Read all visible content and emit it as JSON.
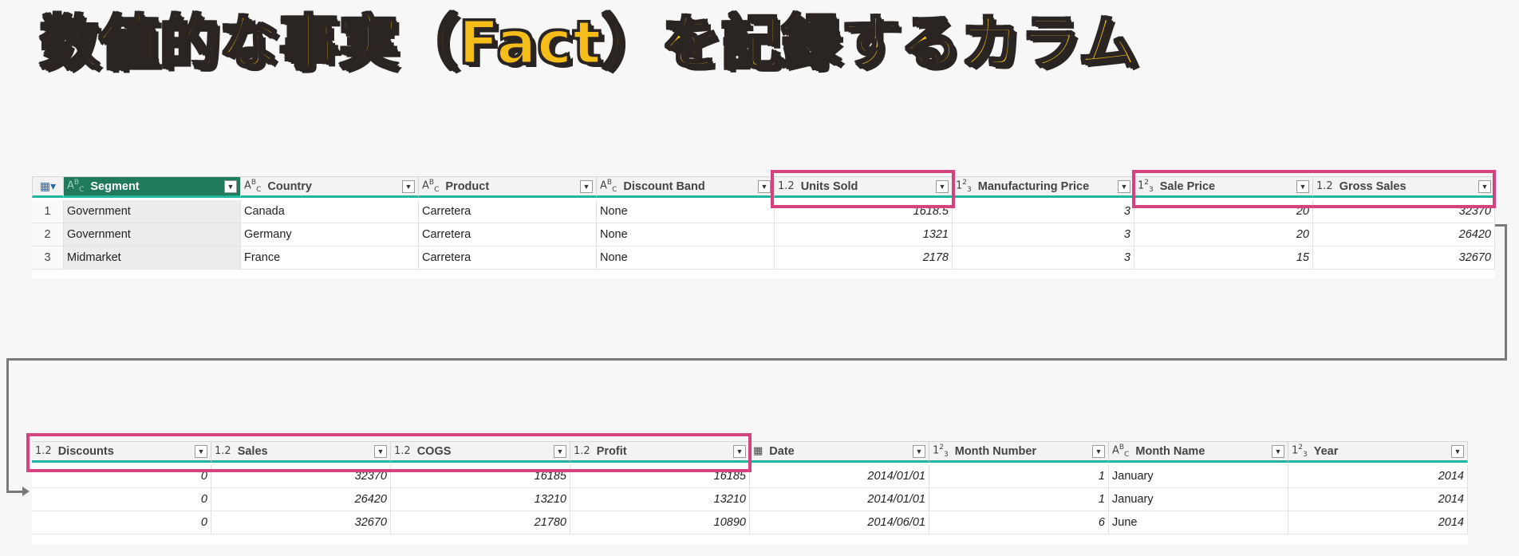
{
  "title": "数値的な事実（Fact）を記録するカラム",
  "colors": {
    "highlight": "#d6417f",
    "selected_header": "#227a5c",
    "underline": "#1fb59e",
    "title_fill": "#f5bd19"
  },
  "table1": {
    "corner_icon": "table-icon",
    "columns": [
      {
        "type": "ABC",
        "name": "Segment"
      },
      {
        "type": "ABC",
        "name": "Country"
      },
      {
        "type": "ABC",
        "name": "Product"
      },
      {
        "type": "ABC",
        "name": "Discount Band"
      },
      {
        "type": "1.2",
        "name": "Units Sold"
      },
      {
        "type": "123",
        "name": "Manufacturing Price"
      },
      {
        "type": "123",
        "name": "Sale Price"
      },
      {
        "type": "1.2",
        "name": "Gross Sales"
      }
    ],
    "rows": [
      {
        "n": "1",
        "c": [
          "Government",
          "Canada",
          "Carretera",
          "None",
          "1618.5",
          "3",
          "20",
          "32370"
        ]
      },
      {
        "n": "2",
        "c": [
          "Government",
          "Germany",
          "Carretera",
          "None",
          "1321",
          "3",
          "20",
          "26420"
        ]
      },
      {
        "n": "3",
        "c": [
          "Midmarket",
          "France",
          "Carretera",
          "None",
          "2178",
          "3",
          "15",
          "32670"
        ]
      }
    ]
  },
  "table2": {
    "columns": [
      {
        "type": "1.2",
        "name": "Discounts"
      },
      {
        "type": "1.2",
        "name": "Sales"
      },
      {
        "type": "1.2",
        "name": "COGS"
      },
      {
        "type": "1.2",
        "name": "Profit"
      },
      {
        "type": "calendar",
        "name": "Date"
      },
      {
        "type": "123",
        "name": "Month Number"
      },
      {
        "type": "ABC",
        "name": "Month Name"
      },
      {
        "type": "123",
        "name": "Year"
      }
    ],
    "rows": [
      {
        "c": [
          "0",
          "32370",
          "16185",
          "16185",
          "2014/01/01",
          "1",
          "January",
          "2014"
        ]
      },
      {
        "c": [
          "0",
          "26420",
          "13210",
          "13210",
          "2014/01/01",
          "1",
          "January",
          "2014"
        ]
      },
      {
        "c": [
          "0",
          "32670",
          "21780",
          "10890",
          "2014/06/01",
          "6",
          "June",
          "2014"
        ]
      }
    ]
  }
}
